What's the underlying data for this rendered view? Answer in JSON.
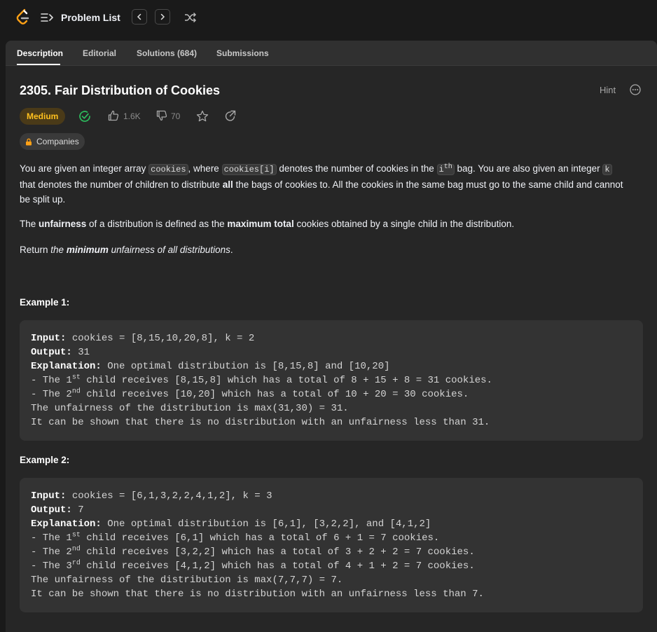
{
  "topbar": {
    "problem_list_label": "Problem List",
    "prev_label": "<",
    "next_label": ">"
  },
  "tabs": [
    {
      "label": "Description"
    },
    {
      "label": "Editorial"
    },
    {
      "label": "Solutions (684)"
    },
    {
      "label": "Submissions"
    }
  ],
  "problem": {
    "title": "2305. Fair Distribution of Cookies",
    "hint_label": "Hint",
    "difficulty": "Medium",
    "likes": "1.6K",
    "dislikes": "70",
    "companies_label": "Companies"
  },
  "description": {
    "p1": {
      "t1": "You are given an integer array ",
      "c1": "cookies",
      "t2": ", where ",
      "c2": "cookies[i]",
      "t3": " denotes the number of cookies in the ",
      "c3": "i",
      "c3_sup": "th",
      "t4": " bag. You are also given an integer ",
      "c4": "k",
      "t5": " that denotes the number of children to distribute ",
      "b1": "all",
      "t6": " the bags of cookies to. All the cookies in the same bag must go to the same child and cannot be split up."
    },
    "p2": {
      "t1": "The ",
      "b1": "unfairness",
      "t2": " of a distribution is defined as the ",
      "b2": "maximum total",
      "t3": " cookies obtained by a single child in the distribution."
    },
    "p3": {
      "t1": "Return ",
      "i1": "the ",
      "bi": "minimum",
      "i2": " unfairness of all distributions",
      "t2": "."
    }
  },
  "examples": [
    {
      "heading": "Example 1:",
      "input_label": "Input:",
      "input": " cookies = [8,15,10,20,8], k = 2",
      "output_label": "Output:",
      "output": " 31",
      "explanation_label": "Explanation:",
      "explanation": " One optimal distribution is [8,15,8] and [10,20]",
      "lines": [
        {
          "pre": "- The 1",
          "sup": "st",
          "post": " child receives [8,15,8] which has a total of 8 + 15 + 8 = 31 cookies."
        },
        {
          "pre": "- The 2",
          "sup": "nd",
          "post": " child receives [10,20] which has a total of 10 + 20 = 30 cookies."
        },
        {
          "pre": "The unfairness of the distribution is max(31,30) = 31.",
          "sup": "",
          "post": ""
        },
        {
          "pre": "It can be shown that there is no distribution with an unfairness less than 31.",
          "sup": "",
          "post": ""
        }
      ]
    },
    {
      "heading": "Example 2:",
      "input_label": "Input:",
      "input": " cookies = [6,1,3,2,2,4,1,2], k = 3",
      "output_label": "Output:",
      "output": " 7",
      "explanation_label": "Explanation:",
      "explanation": " One optimal distribution is [6,1], [3,2,2], and [4,1,2]",
      "lines": [
        {
          "pre": "- The 1",
          "sup": "st",
          "post": " child receives [6,1] which has a total of 6 + 1 = 7 cookies."
        },
        {
          "pre": "- The 2",
          "sup": "nd",
          "post": " child receives [3,2,2] which has a total of 3 + 2 + 2 = 7 cookies."
        },
        {
          "pre": "- The 3",
          "sup": "rd",
          "post": " child receives [4,1,2] which has a total of 4 + 1 + 2 = 7 cookies."
        },
        {
          "pre": "The unfairness of the distribution is max(7,7,7) = 7.",
          "sup": "",
          "post": ""
        },
        {
          "pre": "It can be shown that there is no distribution with an unfairness less than 7.",
          "sup": "",
          "post": ""
        }
      ]
    }
  ],
  "colors": {
    "background": "#1a1a1a",
    "panel": "#262626",
    "medium": "#ffc01e",
    "solved": "#2cbb5d"
  },
  "icons": [
    "leetcode-logo",
    "list-icon",
    "chevron-left-icon",
    "chevron-right-icon",
    "shuffle-icon",
    "more-icon",
    "solved-check-icon",
    "thumbs-up-icon",
    "thumbs-down-icon",
    "star-icon",
    "share-icon",
    "lock-icon"
  ]
}
